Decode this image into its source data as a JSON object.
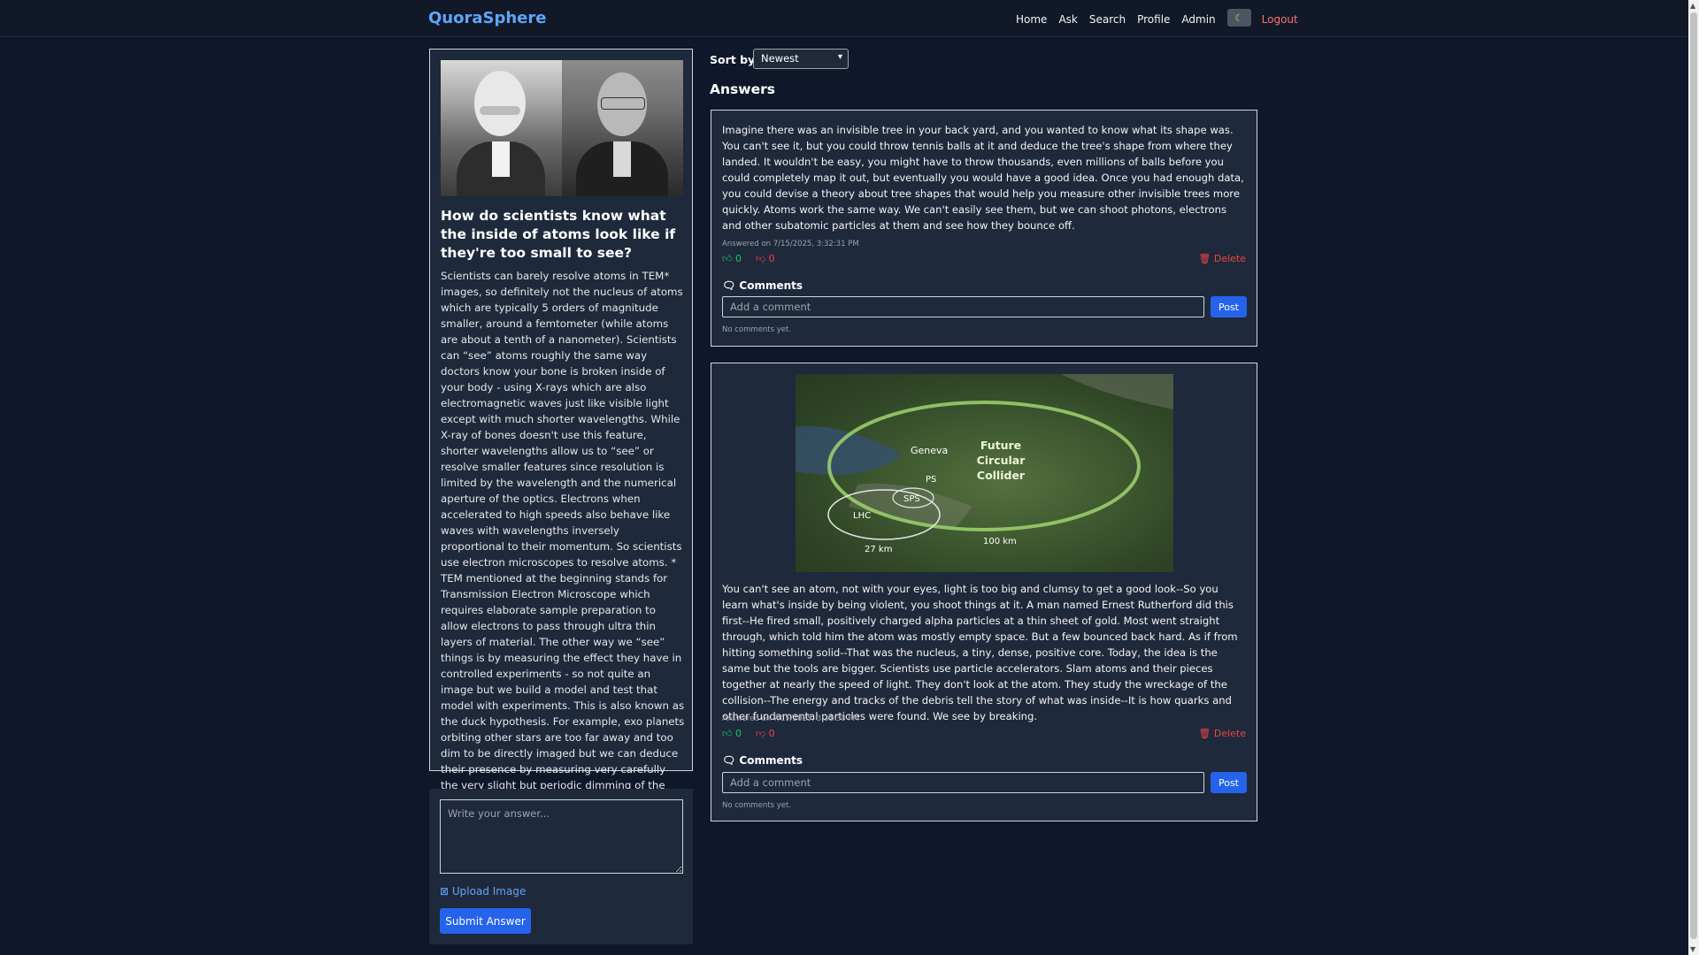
{
  "nav": {
    "brand": "QuoraSphere",
    "links": [
      "Home",
      "Ask",
      "Search",
      "Profile",
      "Admin"
    ],
    "theme_icon": "moon-icon",
    "logout": "Logout"
  },
  "question": {
    "title": "How do scientists know what the inside of atoms look like if they're too small to see?",
    "body": "Scientists can barely resolve atoms in TEM* images, so definitely not the nucleus of atoms which are typically 5 orders of magnitude smaller, around a femtometer (while atoms are about a tenth of a nanometer). Scientists can “see” atoms roughly the same way doctors know your bone is broken inside of your body - using X-rays which are also electromagnetic waves just like visible light except with much shorter wavelengths. While X-ray of bones doesn't use this feature, shorter wavelengths allow us to “see” or resolve smaller features since resolution is limited by the wavelength and the numerical aperture of the optics. Electrons when accelerated to high speeds also behave like waves with wavelengths inversely proportional to their momentum. So scientists use electron microscopes to resolve atoms. * TEM mentioned at the beginning stands for Transmission Electron Microscope which requires elaborate sample preparation to allow electrons to pass through ultra thin layers of material. The other way we “see” things is by measuring the effect they have in controlled experiments - so not quite an image but we build a model and test that model with experiments. This is also known as the duck hypothesis. For example, exo planets orbiting other stars are too far away and too dim to be directly imaged but we can deduce their presence by measuring very carefully the very slight but periodic dimming of the star as the planet passes in front of it."
  },
  "answer_form": {
    "placeholder": "Write your answer...",
    "upload_label": "Upload Image",
    "submit_label": "Submit Answer"
  },
  "sort": {
    "label": "Sort by:",
    "selected": "Newest"
  },
  "answers_heading": "Answers",
  "answers": [
    {
      "text": "Imagine there was an invisible tree in your back yard, and you wanted to know what its shape was. You can't see it, but you could throw tennis balls at it and deduce the tree's shape from where they landed. It wouldn't be easy, you might have to throw thousands, even millions of balls before you could completely map it out, but eventually you would have a good idea. Once you had enough data, you could devise a theory about tree shapes that would help you measure other invisible trees more quickly. Atoms work the same way. We can't easily see them, but we can shoot photons, electrons and other subatomic particles at them and see how they bounce off.",
      "date": "Answered on 7/15/2025, 3:32:31 PM",
      "upvotes": "0",
      "downvotes": "0",
      "delete_label": "Delete",
      "comments_label": "Comments",
      "comment_placeholder": "Add a comment",
      "post_label": "Post",
      "no_comments": "No comments yet."
    },
    {
      "image_labels": {
        "geneva": "Geneva",
        "ps": "PS",
        "sps": "SPS",
        "lhc": "LHC",
        "fcc": "Future Circular Collider",
        "km27": "27 km",
        "km100": "100 km"
      },
      "text": "You can't see an atom, not with your eyes, light is too big and clumsy to get a good look--So you learn what's inside by being violent, you shoot things at it. A man named Ernest Rutherford did this first--He fired small, positively charged alpha particles at a thin sheet of gold. Most went straight through, which told him the atom was mostly empty space. But a few bounced back hard. As if from hitting something solid--That was the nucleus, a tiny, dense, positive core. Today, the idea is the same but the tools are bigger. Scientists use particle accelerators. Slam atoms and their pieces together at nearly the speed of light. They don't look at the atom. They study the wreckage of the collision--The energy and tracks of the debris tell the story of what was inside--It is how quarks and other fundamental particles were found. We see by breaking.",
      "date": "Answered on 7/15/2025, 3:31:38 PM",
      "upvotes": "0",
      "downvotes": "0",
      "delete_label": "Delete",
      "comments_label": "Comments",
      "comment_placeholder": "Add a comment",
      "post_label": "Post",
      "no_comments": "No comments yet."
    }
  ]
}
